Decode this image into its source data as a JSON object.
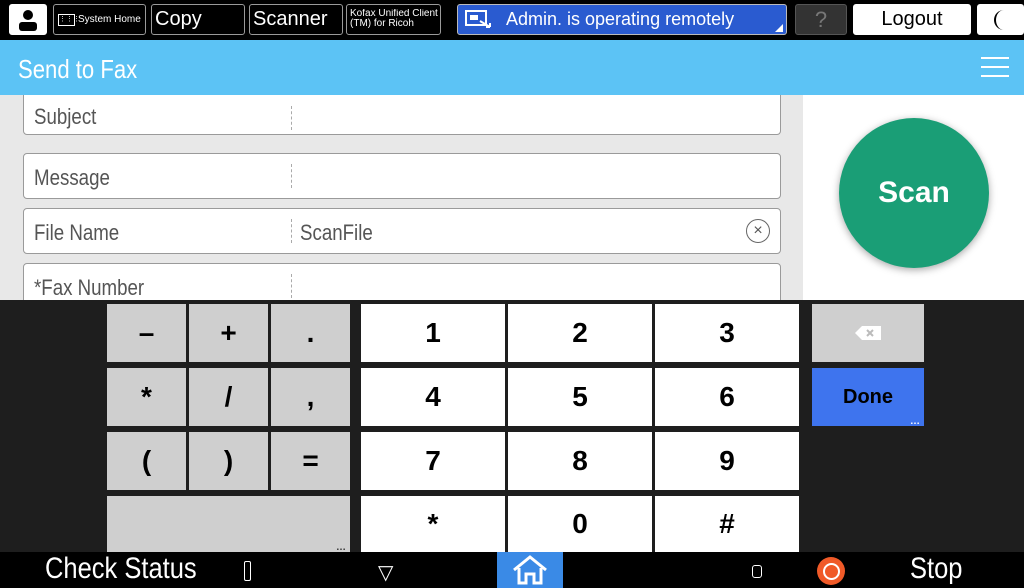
{
  "topbar": {
    "system_home": "System Home",
    "copy": "Copy",
    "scanner": "Scanner",
    "kofax": "Kofax Unified Client (TM) for Ricoh",
    "remote_status": "Admin. is operating remotely",
    "help": "?",
    "logout": "Logout"
  },
  "header": {
    "title": "Send to Fax"
  },
  "fields": [
    {
      "label": "Subject",
      "value": ""
    },
    {
      "label": "Message",
      "value": ""
    },
    {
      "label": "File Name",
      "value": "ScanFile"
    },
    {
      "label": "*Fax Number",
      "value": ""
    }
  ],
  "scan_label": "Scan",
  "keypad": {
    "sym": [
      "–",
      "+",
      ".",
      "*",
      "/",
      ",",
      "(",
      ")",
      "="
    ],
    "digits": [
      "1",
      "2",
      "3",
      "4",
      "5",
      "6",
      "7",
      "8",
      "9",
      "*",
      "0",
      "#"
    ],
    "done": "Done"
  },
  "bottom": {
    "check_status": "Check Status",
    "stop": "Stop"
  }
}
